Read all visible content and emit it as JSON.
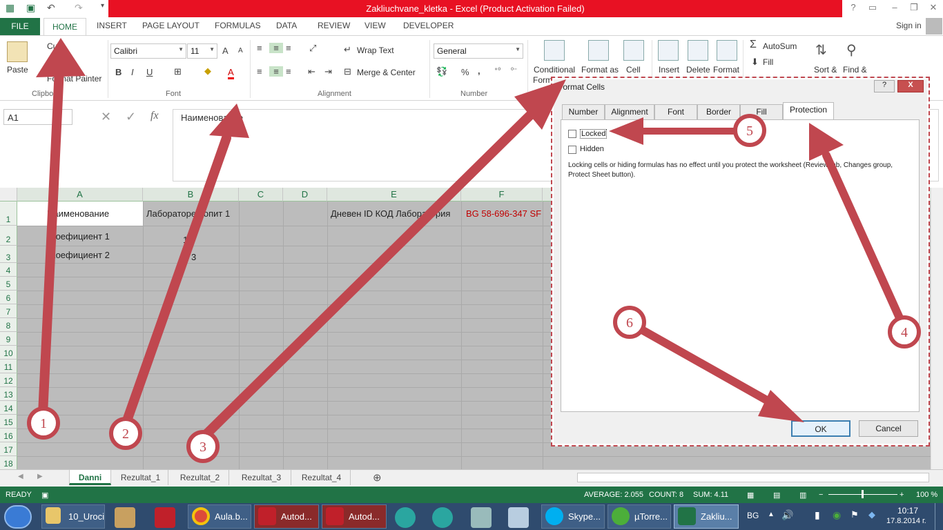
{
  "window": {
    "title": "Zakliuchvane_kletka - Excel (Product Activation Failed)",
    "sign_in": "Sign in"
  },
  "ribbon_tabs": [
    "FILE",
    "HOME",
    "INSERT",
    "PAGE LAYOUT",
    "FORMULAS",
    "DATA",
    "REVIEW",
    "VIEW",
    "DEVELOPER"
  ],
  "clipboard": {
    "paste": "Paste",
    "cut": "Cut",
    "copy": "C",
    "format_painter": "Format Painter",
    "group_label": "Clipboa"
  },
  "font": {
    "name": "Calibri",
    "size": "11",
    "bold": "B",
    "italic": "I",
    "underline": "U",
    "grow": "A",
    "shrink": "A",
    "color_btn": "A",
    "group_label": "Font"
  },
  "alignment": {
    "wrap_text": "Wrap Text",
    "merge_center": "Merge & Center",
    "group_label": "Alignment"
  },
  "number": {
    "format": "General",
    "percent": "%",
    "comma": ",",
    "group_label": "Number"
  },
  "styles": {
    "conditional": "Conditional",
    "conditional_2": "Formi",
    "format_as": "Format as",
    "cell": "Cell"
  },
  "cells_group": {
    "insert": "Insert",
    "delete": "Delete",
    "format": "Format"
  },
  "editing": {
    "autosum": "AutoSum",
    "fill": "Fill",
    "sort": "Sort &",
    "find": "Find &"
  },
  "formula_bar": {
    "name_box": "A1",
    "fx": "fx",
    "content": "Наименование"
  },
  "columns": [
    "A",
    "B",
    "C",
    "D",
    "E",
    "F"
  ],
  "rows": [
    "1",
    "2",
    "3",
    "4",
    "5",
    "6",
    "7",
    "8",
    "9",
    "10",
    "11",
    "12",
    "13",
    "14",
    "15",
    "16",
    "17",
    "18"
  ],
  "cells": {
    "A1": "Наименование",
    "B1": "Лабораторен опит 1",
    "E1": "Дневен ID КОД Лаборатория",
    "F1": "BG 58-696-347 SF",
    "A2": "Коефициент 1",
    "B2": "1",
    "A3": "Коефициент 2",
    "B3": "3"
  },
  "sheets": [
    "Danni",
    "Rezultat_1",
    "Rezultat_2",
    "Rezultat_3",
    "Rezultat_4"
  ],
  "status": {
    "ready": "READY",
    "average": "AVERAGE: 2.055",
    "count": "COUNT: 8",
    "sum": "SUM: 4.11",
    "zoom": "100 %"
  },
  "dialog": {
    "title": "Format Cells",
    "tabs": [
      "Number",
      "Alignment",
      "Font",
      "Border",
      "Fill",
      "Protection"
    ],
    "locked": "Locked",
    "hidden": "Hidden",
    "note": "Locking cells or hiding formulas has no effect until you protect the worksheet (Review tab, Changes group, Protect Sheet button).",
    "ok": "OK",
    "cancel": "Cancel",
    "help": "?",
    "close": "X"
  },
  "annotations": [
    "1",
    "2",
    "3",
    "4",
    "5",
    "6"
  ],
  "taskbar": {
    "items": [
      "10_Uroci",
      "Aula.b...",
      "Autod...",
      "Autod...",
      "Skype...",
      "µTorre...",
      "Zakliu..."
    ],
    "lang": "BG",
    "time": "10:17",
    "date": "17.8.2014 г."
  },
  "colors": {
    "excel_green": "#217346",
    "title_red": "#e81123",
    "arrow": "#c0474f",
    "selected_fill": "#bcbcbc"
  }
}
